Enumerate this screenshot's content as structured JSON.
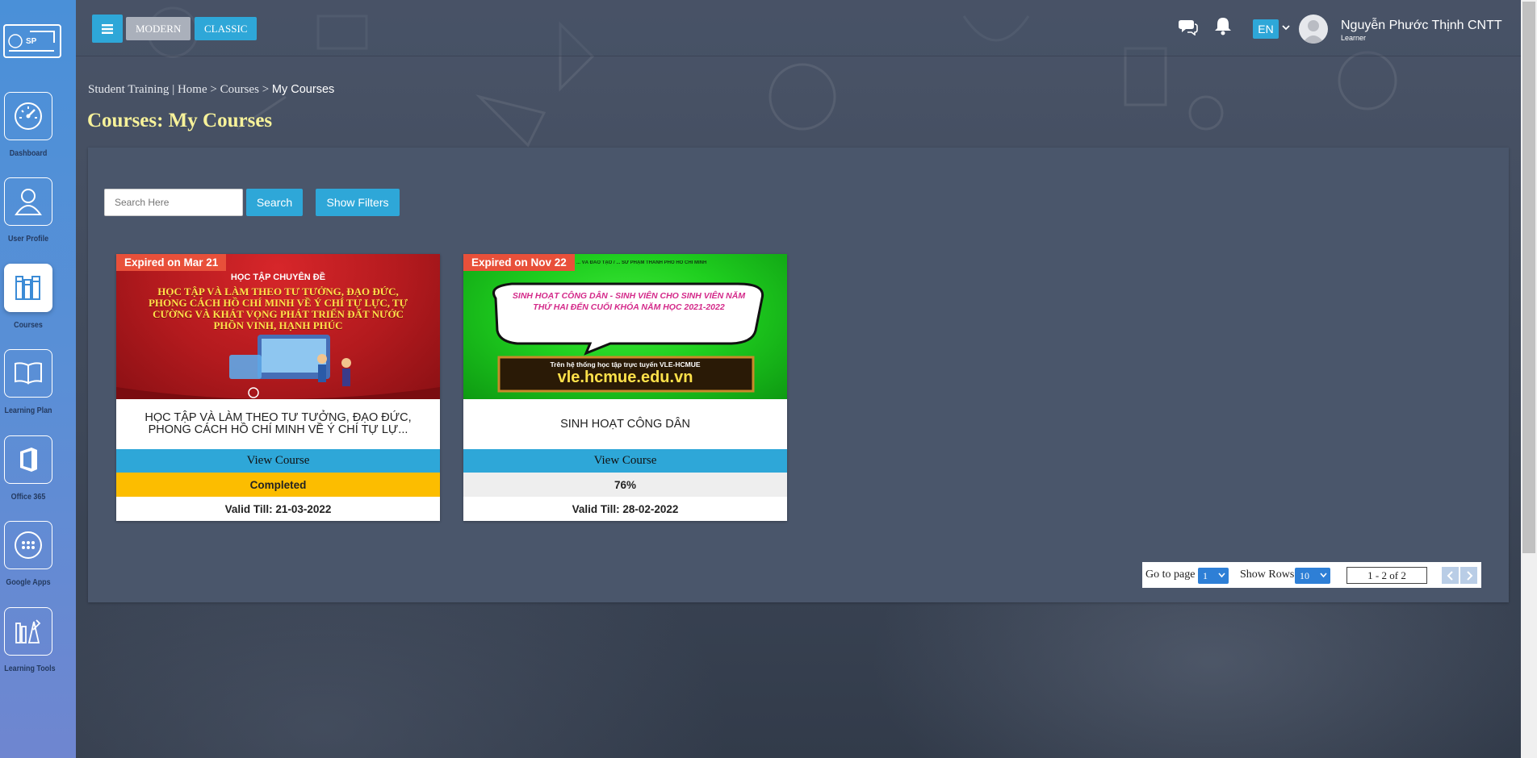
{
  "sidebar": {
    "logo_text": "SP",
    "items": [
      {
        "label": "Dashboard",
        "icon": "speedometer-icon"
      },
      {
        "label": "User Profile",
        "icon": "user-icon"
      },
      {
        "label": "Courses",
        "icon": "books-icon"
      },
      {
        "label": "Learning Plan",
        "icon": "open-book-icon"
      },
      {
        "label": "Office 365",
        "icon": "office-icon"
      },
      {
        "label": "Google Apps",
        "icon": "apps-grid-icon"
      },
      {
        "label": "Learning Tools",
        "icon": "tools-icon"
      }
    ],
    "active_index": 2
  },
  "topbar": {
    "modern_label": "MODERN",
    "classic_label": "CLASSIC",
    "language": "EN",
    "user_name": "Nguyễn Phước Thịnh CNTT",
    "user_role": "Learner"
  },
  "breadcrumb": {
    "root": "Student Training",
    "separator": "|",
    "home": "Home",
    "arrow": ">",
    "courses": "Courses",
    "current": "My Courses"
  },
  "page_title": "Courses: My Courses",
  "search": {
    "placeholder": "Search Here",
    "button_label": "Search",
    "filters_label": "Show Filters"
  },
  "courses": [
    {
      "badge": "Expired on Mar 21",
      "image_heading": "HỌC TẬP CHUYÊN ĐỀ",
      "image_text": "HỌC TẬP VÀ LÀM THEO TƯ TƯỞNG, ĐẠO ĐỨC, PHONG CÁCH HỒ CHÍ MINH VỀ Ý CHÍ TỰ LỰC, TỰ CƯỜNG VÀ KHÁT VỌNG PHÁT TRIỂN ĐẤT NƯỚC PHỒN VINH, HẠNH PHÚC",
      "title": "HỌC TẬP VÀ LÀM THEO TƯ TƯỞNG, ĐẠO ĐỨC, PHONG CÁCH HỒ CHÍ MINH VỀ Ý CHÍ TỰ LỰ...",
      "view_label": "View Course",
      "status": "Completed",
      "status_color": "#fcbd00",
      "valid": "Valid Till: 21-03-2022"
    },
    {
      "badge": "Expired on Nov 22",
      "image_header": "... VÀ ĐÀO TẠO / ... SƯ PHẠM THÀNH PHỐ HỒ CHÍ MINH",
      "image_text": "SINH HOẠT CÔNG DÂN - SINH VIÊN CHO SINH VIÊN NĂM THỨ HAI ĐẾN CUỐI KHÓA NĂM HỌC 2021-2022",
      "image_footer_small": "Trên hệ thống học tập trực tuyến VLE-HCMUE",
      "image_footer_url": "vle.hcmue.edu.vn",
      "title": "SINH HOẠT CÔNG DÂN",
      "view_label": "View Course",
      "status": "76%",
      "status_color": "#eeeeee",
      "valid": "Valid Till: 28-02-2022"
    }
  ],
  "pagination": {
    "goto_label": "Go to page",
    "page_value": "1",
    "rows_label": "Show Rows",
    "rows_value": "10",
    "range": "1 - 2 of 2"
  },
  "colors": {
    "accent": "#2ea7d8",
    "badge": "#e8503a",
    "title": "#f7f29a",
    "panel": "#4a566b"
  }
}
